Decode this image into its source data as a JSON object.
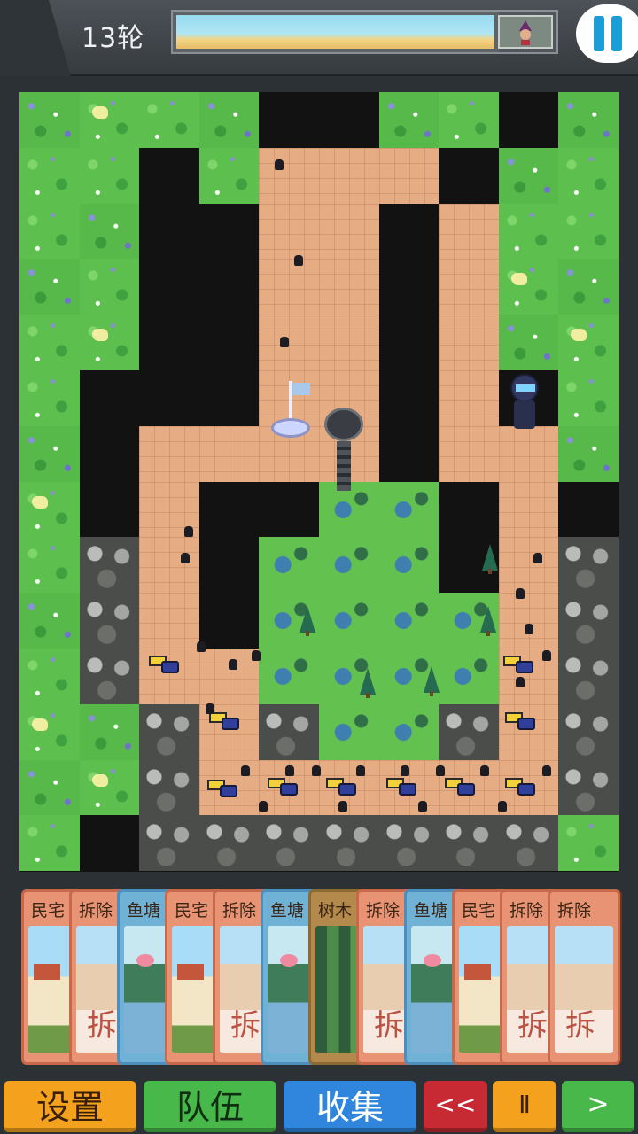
{
  "header": {
    "round_label": "13轮",
    "wave_progress": 0.85
  },
  "hand": {
    "cards": [
      {
        "title": "民宅",
        "kind": "house"
      },
      {
        "title": "拆除",
        "kind": "demolish"
      },
      {
        "title": "鱼塘",
        "kind": "fish"
      },
      {
        "title": "民宅",
        "kind": "house"
      },
      {
        "title": "拆除",
        "kind": "demolish"
      },
      {
        "title": "鱼塘",
        "kind": "fish"
      },
      {
        "title": "树木",
        "kind": "forest"
      },
      {
        "title": "拆除",
        "kind": "demolish"
      },
      {
        "title": "鱼塘",
        "kind": "fish"
      },
      {
        "title": "民宅",
        "kind": "house"
      },
      {
        "title": "拆除",
        "kind": "demolish"
      },
      {
        "title": "拆除",
        "kind": "demolish"
      }
    ]
  },
  "buttons": {
    "settings": "设置",
    "team": "队伍",
    "collect": "收集",
    "rewind": "<<",
    "pause": "Ⅱ",
    "forward": ">"
  },
  "colors": {
    "accent_blue": "#1b9ed8",
    "path": "#e6ad84",
    "grass": "#5cbf4e"
  }
}
